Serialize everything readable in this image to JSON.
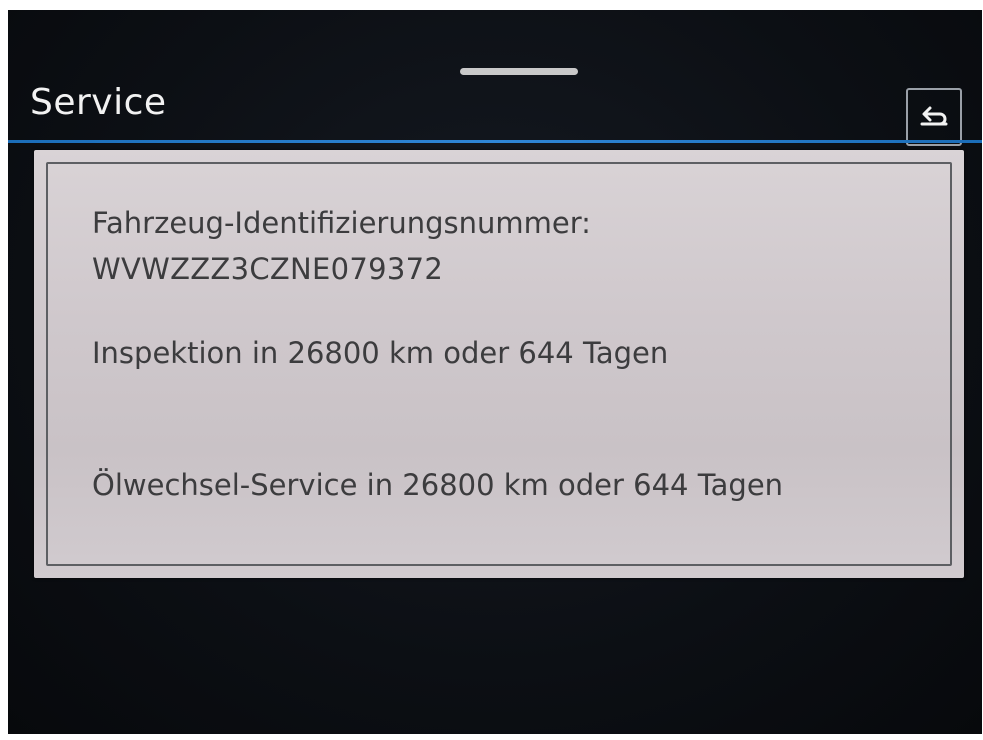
{
  "header": {
    "title": "Service",
    "back_icon": "back-arrow-icon"
  },
  "panel": {
    "vin_label": "Fahrzeug-Identifizierungsnummer:",
    "vin_value": "WVWZZZ3CZNE079372",
    "inspection": "Inspektion in 26800 km oder 644 Tagen",
    "oil_service": "Ölwechsel-Service in 26800 km oder 644 Tagen"
  },
  "colors": {
    "accent_line": "#2f86d6",
    "background": "#0c0f14",
    "panel": "#d3cdd0",
    "text": "#3c3c3e"
  }
}
